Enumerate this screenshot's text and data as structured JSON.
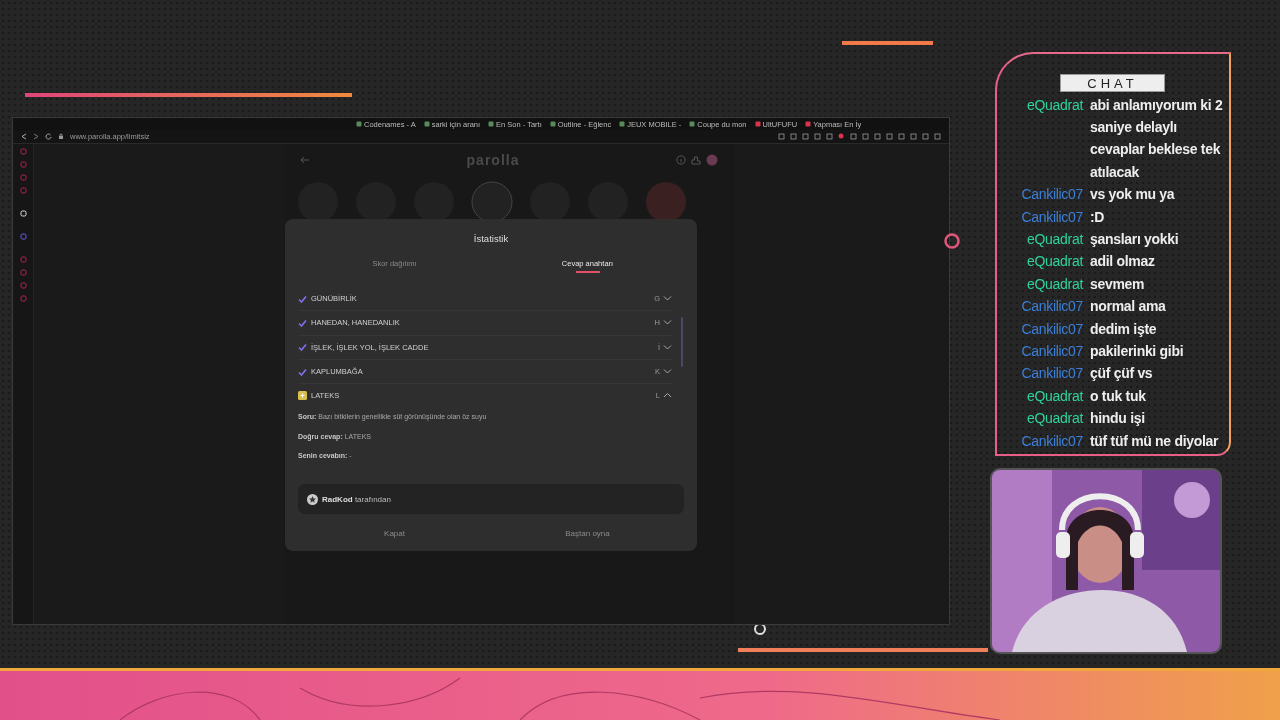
{
  "browser": {
    "tabs": [
      {
        "title": "Codenames - A",
        "selected": false
      },
      {
        "title": "sarki için aranı",
        "selected": false
      },
      {
        "title": "En Son - Tartı",
        "selected": false
      },
      {
        "title": "Outline - Eğlenc",
        "selected": false
      },
      {
        "title": "JEUX MOBILE -",
        "selected": false
      },
      {
        "title": "Coupe du mon",
        "selected": false
      },
      {
        "title": "UltUFUFU",
        "selected": false
      },
      {
        "title": "Yapması En İy",
        "selected": false
      }
    ],
    "url": "www.parolla.app/limitsiz"
  },
  "app": {
    "logo": "parolla"
  },
  "dialog": {
    "title": "İstatistik",
    "tabs": [
      {
        "label": "Skor dağılımı",
        "selected": false
      },
      {
        "label": "Cevap anahtarı",
        "selected": true
      }
    ],
    "answers": [
      {
        "kind": "correct",
        "word": "GÜNÜBİRLİK",
        "letter": "G",
        "expanded": false
      },
      {
        "kind": "correct",
        "word": "HANEDAN, HANEDANLIK",
        "letter": "H",
        "expanded": false
      },
      {
        "kind": "correct",
        "word": "İŞLEK, İŞLEK YOL, İŞLEK CADDE",
        "letter": "İ",
        "expanded": false
      },
      {
        "kind": "correct",
        "word": "KAPLUMBAĞA",
        "letter": "K",
        "expanded": false
      },
      {
        "kind": "passed",
        "word": "LATEKS",
        "letter": "L",
        "expanded": true,
        "details": [
          "**Soru:** Bazı bitkilerin genellikle süt görünüşünde olan öz suyu",
          "**Doğru cevap:** LATEKS",
          "**Senin cevabın:** -"
        ]
      }
    ],
    "credit": "**RadKod** tarafından",
    "buttons": [
      "Kapat",
      "Baştan oyna"
    ]
  },
  "chat": {
    "title": "CHAT",
    "messages": [
      {
        "user": "eQuadrat",
        "color": "#2fd39a",
        "text": "abi anlamıyorum ki 2 saniye delaylı cevaplar beklese tek atılacak"
      },
      {
        "user": "Cankilic07",
        "color": "#3b7fd8",
        "text": "vs yok mu ya"
      },
      {
        "user": "Cankilic07",
        "color": "#3b7fd8",
        "text": ":D"
      },
      {
        "user": "eQuadrat",
        "color": "#2fd39a",
        "text": "şansları yokki"
      },
      {
        "user": "eQuadrat",
        "color": "#2fd39a",
        "text": "adil olmaz"
      },
      {
        "user": "eQuadrat",
        "color": "#2fd39a",
        "text": "sevmem"
      },
      {
        "user": "Cankilic07",
        "color": "#3b7fd8",
        "text": "normal ama"
      },
      {
        "user": "Cankilic07",
        "color": "#3b7fd8",
        "text": "dedim işte"
      },
      {
        "user": "Cankilic07",
        "color": "#3b7fd8",
        "text": "pakilerinki gibi"
      },
      {
        "user": "Cankilic07",
        "color": "#3b7fd8",
        "text": "çüf çüf vs"
      },
      {
        "user": "eQuadrat",
        "color": "#2fd39a",
        "text": "o tuk tuk"
      },
      {
        "user": "eQuadrat",
        "color": "#2fd39a",
        "text": "hindu işi"
      },
      {
        "user": "Cankilic07",
        "color": "#3b7fd8",
        "text": "tüf tüf mü ne diyolar"
      }
    ]
  }
}
